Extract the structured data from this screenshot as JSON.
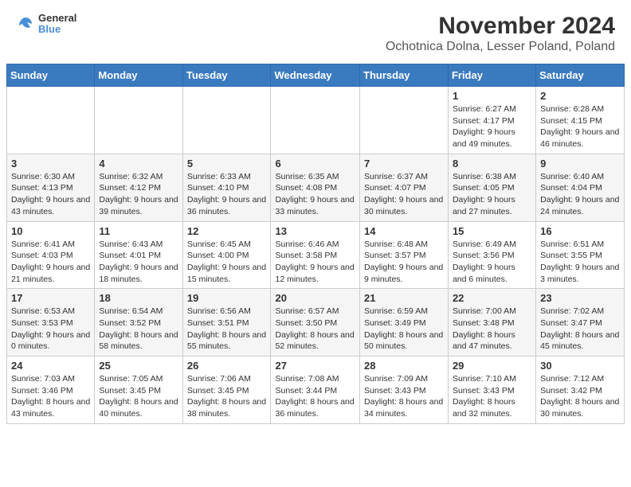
{
  "header": {
    "logo_line1": "General",
    "logo_line2": "Blue",
    "main_title": "November 2024",
    "subtitle": "Ochotnica Dolna, Lesser Poland, Poland"
  },
  "days_of_week": [
    "Sunday",
    "Monday",
    "Tuesday",
    "Wednesday",
    "Thursday",
    "Friday",
    "Saturday"
  ],
  "weeks": [
    [
      {
        "day": "",
        "info": ""
      },
      {
        "day": "",
        "info": ""
      },
      {
        "day": "",
        "info": ""
      },
      {
        "day": "",
        "info": ""
      },
      {
        "day": "",
        "info": ""
      },
      {
        "day": "1",
        "info": "Sunrise: 6:27 AM\nSunset: 4:17 PM\nDaylight: 9 hours and 49 minutes."
      },
      {
        "day": "2",
        "info": "Sunrise: 6:28 AM\nSunset: 4:15 PM\nDaylight: 9 hours and 46 minutes."
      }
    ],
    [
      {
        "day": "3",
        "info": "Sunrise: 6:30 AM\nSunset: 4:13 PM\nDaylight: 9 hours and 43 minutes."
      },
      {
        "day": "4",
        "info": "Sunrise: 6:32 AM\nSunset: 4:12 PM\nDaylight: 9 hours and 39 minutes."
      },
      {
        "day": "5",
        "info": "Sunrise: 6:33 AM\nSunset: 4:10 PM\nDaylight: 9 hours and 36 minutes."
      },
      {
        "day": "6",
        "info": "Sunrise: 6:35 AM\nSunset: 4:08 PM\nDaylight: 9 hours and 33 minutes."
      },
      {
        "day": "7",
        "info": "Sunrise: 6:37 AM\nSunset: 4:07 PM\nDaylight: 9 hours and 30 minutes."
      },
      {
        "day": "8",
        "info": "Sunrise: 6:38 AM\nSunset: 4:05 PM\nDaylight: 9 hours and 27 minutes."
      },
      {
        "day": "9",
        "info": "Sunrise: 6:40 AM\nSunset: 4:04 PM\nDaylight: 9 hours and 24 minutes."
      }
    ],
    [
      {
        "day": "10",
        "info": "Sunrise: 6:41 AM\nSunset: 4:03 PM\nDaylight: 9 hours and 21 minutes."
      },
      {
        "day": "11",
        "info": "Sunrise: 6:43 AM\nSunset: 4:01 PM\nDaylight: 9 hours and 18 minutes."
      },
      {
        "day": "12",
        "info": "Sunrise: 6:45 AM\nSunset: 4:00 PM\nDaylight: 9 hours and 15 minutes."
      },
      {
        "day": "13",
        "info": "Sunrise: 6:46 AM\nSunset: 3:58 PM\nDaylight: 9 hours and 12 minutes."
      },
      {
        "day": "14",
        "info": "Sunrise: 6:48 AM\nSunset: 3:57 PM\nDaylight: 9 hours and 9 minutes."
      },
      {
        "day": "15",
        "info": "Sunrise: 6:49 AM\nSunset: 3:56 PM\nDaylight: 9 hours and 6 minutes."
      },
      {
        "day": "16",
        "info": "Sunrise: 6:51 AM\nSunset: 3:55 PM\nDaylight: 9 hours and 3 minutes."
      }
    ],
    [
      {
        "day": "17",
        "info": "Sunrise: 6:53 AM\nSunset: 3:53 PM\nDaylight: 9 hours and 0 minutes."
      },
      {
        "day": "18",
        "info": "Sunrise: 6:54 AM\nSunset: 3:52 PM\nDaylight: 8 hours and 58 minutes."
      },
      {
        "day": "19",
        "info": "Sunrise: 6:56 AM\nSunset: 3:51 PM\nDaylight: 8 hours and 55 minutes."
      },
      {
        "day": "20",
        "info": "Sunrise: 6:57 AM\nSunset: 3:50 PM\nDaylight: 8 hours and 52 minutes."
      },
      {
        "day": "21",
        "info": "Sunrise: 6:59 AM\nSunset: 3:49 PM\nDaylight: 8 hours and 50 minutes."
      },
      {
        "day": "22",
        "info": "Sunrise: 7:00 AM\nSunset: 3:48 PM\nDaylight: 8 hours and 47 minutes."
      },
      {
        "day": "23",
        "info": "Sunrise: 7:02 AM\nSunset: 3:47 PM\nDaylight: 8 hours and 45 minutes."
      }
    ],
    [
      {
        "day": "24",
        "info": "Sunrise: 7:03 AM\nSunset: 3:46 PM\nDaylight: 8 hours and 43 minutes."
      },
      {
        "day": "25",
        "info": "Sunrise: 7:05 AM\nSunset: 3:45 PM\nDaylight: 8 hours and 40 minutes."
      },
      {
        "day": "26",
        "info": "Sunrise: 7:06 AM\nSunset: 3:45 PM\nDaylight: 8 hours and 38 minutes."
      },
      {
        "day": "27",
        "info": "Sunrise: 7:08 AM\nSunset: 3:44 PM\nDaylight: 8 hours and 36 minutes."
      },
      {
        "day": "28",
        "info": "Sunrise: 7:09 AM\nSunset: 3:43 PM\nDaylight: 8 hours and 34 minutes."
      },
      {
        "day": "29",
        "info": "Sunrise: 7:10 AM\nSunset: 3:43 PM\nDaylight: 8 hours and 32 minutes."
      },
      {
        "day": "30",
        "info": "Sunrise: 7:12 AM\nSunset: 3:42 PM\nDaylight: 8 hours and 30 minutes."
      }
    ]
  ]
}
